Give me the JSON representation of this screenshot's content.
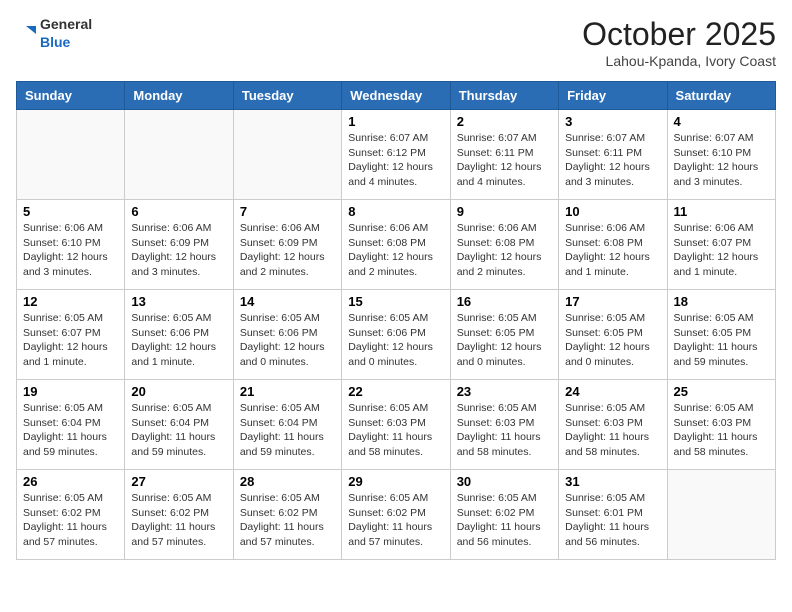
{
  "header": {
    "logo_line1": "General",
    "logo_line2": "Blue",
    "month": "October 2025",
    "location": "Lahou-Kpanda, Ivory Coast"
  },
  "weekdays": [
    "Sunday",
    "Monday",
    "Tuesday",
    "Wednesday",
    "Thursday",
    "Friday",
    "Saturday"
  ],
  "weeks": [
    [
      {
        "day": "",
        "info": ""
      },
      {
        "day": "",
        "info": ""
      },
      {
        "day": "",
        "info": ""
      },
      {
        "day": "1",
        "info": "Sunrise: 6:07 AM\nSunset: 6:12 PM\nDaylight: 12 hours\nand 4 minutes."
      },
      {
        "day": "2",
        "info": "Sunrise: 6:07 AM\nSunset: 6:11 PM\nDaylight: 12 hours\nand 4 minutes."
      },
      {
        "day": "3",
        "info": "Sunrise: 6:07 AM\nSunset: 6:11 PM\nDaylight: 12 hours\nand 3 minutes."
      },
      {
        "day": "4",
        "info": "Sunrise: 6:07 AM\nSunset: 6:10 PM\nDaylight: 12 hours\nand 3 minutes."
      }
    ],
    [
      {
        "day": "5",
        "info": "Sunrise: 6:06 AM\nSunset: 6:10 PM\nDaylight: 12 hours\nand 3 minutes."
      },
      {
        "day": "6",
        "info": "Sunrise: 6:06 AM\nSunset: 6:09 PM\nDaylight: 12 hours\nand 3 minutes."
      },
      {
        "day": "7",
        "info": "Sunrise: 6:06 AM\nSunset: 6:09 PM\nDaylight: 12 hours\nand 2 minutes."
      },
      {
        "day": "8",
        "info": "Sunrise: 6:06 AM\nSunset: 6:08 PM\nDaylight: 12 hours\nand 2 minutes."
      },
      {
        "day": "9",
        "info": "Sunrise: 6:06 AM\nSunset: 6:08 PM\nDaylight: 12 hours\nand 2 minutes."
      },
      {
        "day": "10",
        "info": "Sunrise: 6:06 AM\nSunset: 6:08 PM\nDaylight: 12 hours\nand 1 minute."
      },
      {
        "day": "11",
        "info": "Sunrise: 6:06 AM\nSunset: 6:07 PM\nDaylight: 12 hours\nand 1 minute."
      }
    ],
    [
      {
        "day": "12",
        "info": "Sunrise: 6:05 AM\nSunset: 6:07 PM\nDaylight: 12 hours\nand 1 minute."
      },
      {
        "day": "13",
        "info": "Sunrise: 6:05 AM\nSunset: 6:06 PM\nDaylight: 12 hours\nand 1 minute."
      },
      {
        "day": "14",
        "info": "Sunrise: 6:05 AM\nSunset: 6:06 PM\nDaylight: 12 hours\nand 0 minutes."
      },
      {
        "day": "15",
        "info": "Sunrise: 6:05 AM\nSunset: 6:06 PM\nDaylight: 12 hours\nand 0 minutes."
      },
      {
        "day": "16",
        "info": "Sunrise: 6:05 AM\nSunset: 6:05 PM\nDaylight: 12 hours\nand 0 minutes."
      },
      {
        "day": "17",
        "info": "Sunrise: 6:05 AM\nSunset: 6:05 PM\nDaylight: 12 hours\nand 0 minutes."
      },
      {
        "day": "18",
        "info": "Sunrise: 6:05 AM\nSunset: 6:05 PM\nDaylight: 11 hours\nand 59 minutes."
      }
    ],
    [
      {
        "day": "19",
        "info": "Sunrise: 6:05 AM\nSunset: 6:04 PM\nDaylight: 11 hours\nand 59 minutes."
      },
      {
        "day": "20",
        "info": "Sunrise: 6:05 AM\nSunset: 6:04 PM\nDaylight: 11 hours\nand 59 minutes."
      },
      {
        "day": "21",
        "info": "Sunrise: 6:05 AM\nSunset: 6:04 PM\nDaylight: 11 hours\nand 59 minutes."
      },
      {
        "day": "22",
        "info": "Sunrise: 6:05 AM\nSunset: 6:03 PM\nDaylight: 11 hours\nand 58 minutes."
      },
      {
        "day": "23",
        "info": "Sunrise: 6:05 AM\nSunset: 6:03 PM\nDaylight: 11 hours\nand 58 minutes."
      },
      {
        "day": "24",
        "info": "Sunrise: 6:05 AM\nSunset: 6:03 PM\nDaylight: 11 hours\nand 58 minutes."
      },
      {
        "day": "25",
        "info": "Sunrise: 6:05 AM\nSunset: 6:03 PM\nDaylight: 11 hours\nand 58 minutes."
      }
    ],
    [
      {
        "day": "26",
        "info": "Sunrise: 6:05 AM\nSunset: 6:02 PM\nDaylight: 11 hours\nand 57 minutes."
      },
      {
        "day": "27",
        "info": "Sunrise: 6:05 AM\nSunset: 6:02 PM\nDaylight: 11 hours\nand 57 minutes."
      },
      {
        "day": "28",
        "info": "Sunrise: 6:05 AM\nSunset: 6:02 PM\nDaylight: 11 hours\nand 57 minutes."
      },
      {
        "day": "29",
        "info": "Sunrise: 6:05 AM\nSunset: 6:02 PM\nDaylight: 11 hours\nand 57 minutes."
      },
      {
        "day": "30",
        "info": "Sunrise: 6:05 AM\nSunset: 6:02 PM\nDaylight: 11 hours\nand 56 minutes."
      },
      {
        "day": "31",
        "info": "Sunrise: 6:05 AM\nSunset: 6:01 PM\nDaylight: 11 hours\nand 56 minutes."
      },
      {
        "day": "",
        "info": ""
      }
    ]
  ]
}
